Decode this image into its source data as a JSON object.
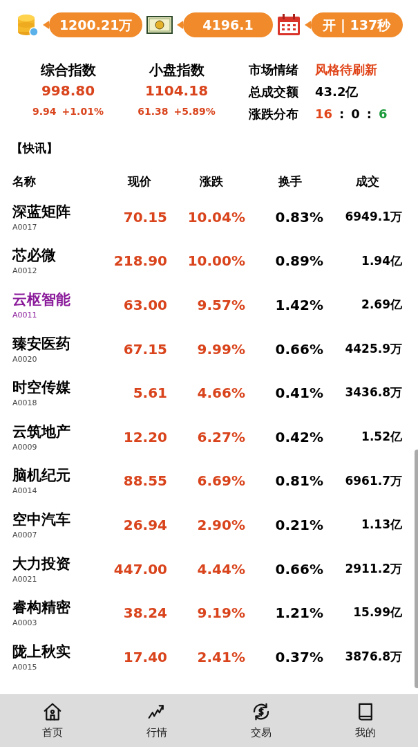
{
  "top_bar": [
    {
      "kind": "coins",
      "value": "1200.21万"
    },
    {
      "kind": "cash",
      "value": "4196.1"
    },
    {
      "kind": "calendar",
      "value": "开 | 137秒"
    }
  ],
  "indices": [
    {
      "name": "综合指数",
      "value": "998.80",
      "change": "9.94",
      "percent": "+1.01%"
    },
    {
      "name": "小盘指数",
      "value": "1104.18",
      "change": "61.38",
      "percent": "+5.89%"
    }
  ],
  "market": {
    "sentiment_label": "市场情绪",
    "sentiment": "风格待刷新",
    "turnover_label": "总成交额",
    "turnover": "43.2亿",
    "breadth_label": "涨跌分布",
    "up": "16",
    "flat": "0",
    "down": "6",
    "separators": [
      ":",
      ":"
    ]
  },
  "news_heading": "【快讯】",
  "table": {
    "columns": [
      "名称",
      "现价",
      "涨跌",
      "换手",
      "成交"
    ],
    "rows": [
      {
        "name": "深蓝矩阵",
        "code": "A0017",
        "price": "70.15",
        "change": "10.04%",
        "turnover": "0.83%",
        "volume": "6949.1万",
        "selected": false
      },
      {
        "name": "芯必微",
        "code": "A0012",
        "price": "218.90",
        "change": "10.00%",
        "turnover": "0.89%",
        "volume": "1.94亿",
        "selected": false
      },
      {
        "name": "云枢智能",
        "code": "A0011",
        "price": "63.00",
        "change": "9.57%",
        "turnover": "1.42%",
        "volume": "2.69亿",
        "selected": true
      },
      {
        "name": "臻安医药",
        "code": "A0020",
        "price": "67.15",
        "change": "9.99%",
        "turnover": "0.66%",
        "volume": "4425.9万",
        "selected": false
      },
      {
        "name": "时空传媒",
        "code": "A0018",
        "price": "5.61",
        "change": "4.66%",
        "turnover": "0.41%",
        "volume": "3436.8万",
        "selected": false
      },
      {
        "name": "云筑地产",
        "code": "A0009",
        "price": "12.20",
        "change": "6.27%",
        "turnover": "0.42%",
        "volume": "1.52亿",
        "selected": false
      },
      {
        "name": "脑机纪元",
        "code": "A0014",
        "price": "88.55",
        "change": "6.69%",
        "turnover": "0.81%",
        "volume": "6961.7万",
        "selected": false
      },
      {
        "name": "空中汽车",
        "code": "A0007",
        "price": "26.94",
        "change": "2.90%",
        "turnover": "0.21%",
        "volume": "1.13亿",
        "selected": false
      },
      {
        "name": "大力投资",
        "code": "A0021",
        "price": "447.00",
        "change": "4.44%",
        "turnover": "0.66%",
        "volume": "2911.2万",
        "selected": false
      },
      {
        "name": "睿构精密",
        "code": "A0003",
        "price": "38.24",
        "change": "9.19%",
        "turnover": "1.21%",
        "volume": "15.99亿",
        "selected": false
      },
      {
        "name": "陇上秋实",
        "code": "A0015",
        "price": "17.40",
        "change": "2.41%",
        "turnover": "0.37%",
        "volume": "3876.8万",
        "selected": false
      }
    ]
  },
  "bottom_nav": [
    {
      "kind": "home",
      "label": "首页"
    },
    {
      "kind": "chart",
      "label": "行情"
    },
    {
      "kind": "trade",
      "label": "交易"
    },
    {
      "kind": "book",
      "label": "我的"
    }
  ]
}
